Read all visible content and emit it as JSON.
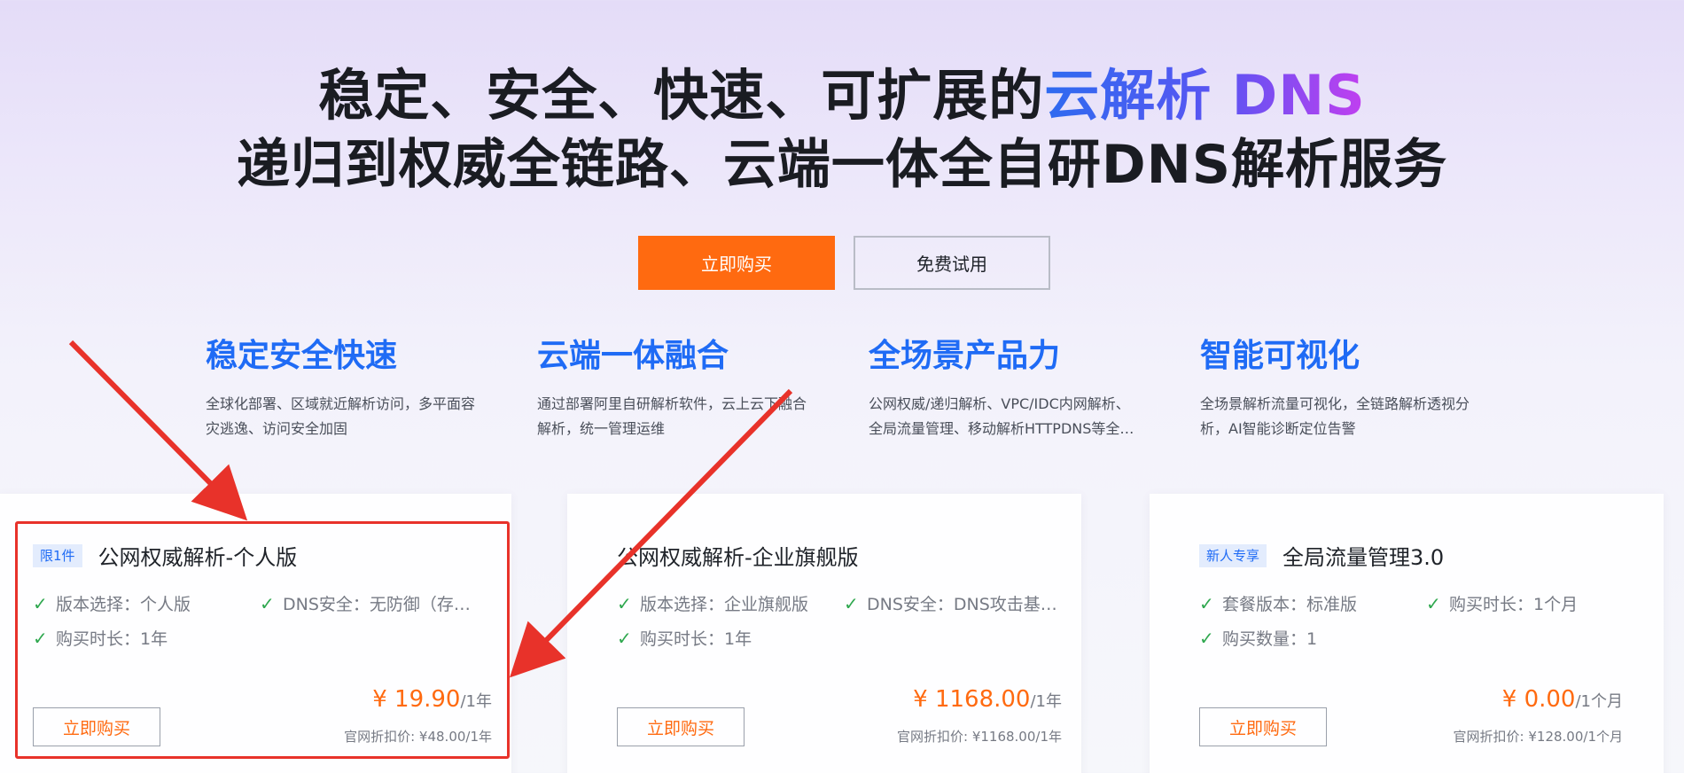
{
  "hero": {
    "line1_main": "稳定、安全、快速、可扩展的",
    "line1_accent": "云解析 DNS",
    "line2": "递归到权威全链路、云端一体全自研DNS解析服务",
    "buy_label": "立即购买",
    "trial_label": "免费试用"
  },
  "features": [
    {
      "title": "稳定安全快速",
      "desc_lines": [
        "全球化部署、区域就近解析访问，多平面容",
        "灾逃逸、访问安全加固"
      ]
    },
    {
      "title": "云端一体融合",
      "desc_lines": [
        "通过部署阿里自研解析软件，云上云下融合",
        "解析，统一管理运维"
      ]
    },
    {
      "title": "全场景产品力",
      "desc_lines": [
        "公网权威/递归解析、VPC/IDC内网解析、",
        "全局流量管理、移动解析HTTPDNS等全…"
      ]
    },
    {
      "title": "智能可视化",
      "desc_lines": [
        "全场景解析流量可视化，全链路解析透视分",
        "析，AI智能诊断定位告警"
      ]
    }
  ],
  "cards": [
    {
      "tag": "限1件",
      "title": "公网权威解析-个人版",
      "specs": [
        "版本选择：个人版",
        "DNS安全：无防御（存…",
        "购买时长：1年"
      ],
      "price": "¥ 19.90",
      "price_unit": "/1年",
      "original": "官网折扣价: ¥48.00/1年",
      "buy_label": "立即购买"
    },
    {
      "tag": "",
      "title": "公网权威解析-企业旗舰版",
      "specs": [
        "版本选择：企业旗舰版",
        "DNS安全：DNS攻击基…",
        "购买时长：1年"
      ],
      "price": "¥ 1168.00",
      "price_unit": "/1年",
      "original": "官网折扣价: ¥1168.00/1年",
      "buy_label": "立即购买"
    },
    {
      "tag": "新人专享",
      "title": "全局流量管理3.0",
      "specs": [
        "套餐版本：标准版",
        "购买时长：1个月",
        "购买数量：1"
      ],
      "price": "¥ 0.00",
      "price_unit": "/1个月",
      "original": "官网折扣价: ¥128.00/1个月",
      "buy_label": "立即购买"
    }
  ],
  "icons": {
    "spec_check": "check-icon",
    "annotation_arrow": "arrow-icon"
  },
  "colors": {
    "accent_orange": "#ff6a10",
    "brand_blue": "#1f6bf5",
    "check_green": "#2fa84f",
    "annotation_red": "#e8322a"
  }
}
